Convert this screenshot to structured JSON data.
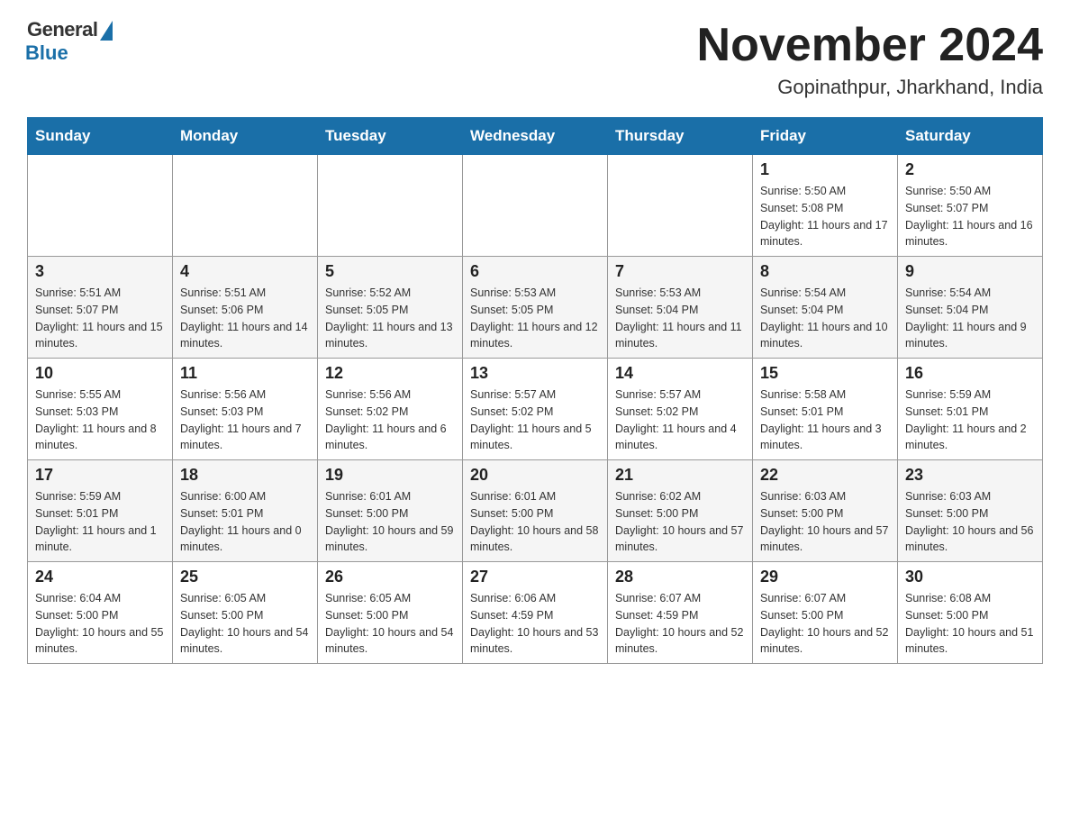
{
  "logo": {
    "general": "General",
    "blue": "Blue"
  },
  "title": "November 2024",
  "location": "Gopinathpur, Jharkhand, India",
  "weekdays": [
    "Sunday",
    "Monday",
    "Tuesday",
    "Wednesday",
    "Thursday",
    "Friday",
    "Saturday"
  ],
  "weeks": [
    [
      {
        "day": "",
        "info": ""
      },
      {
        "day": "",
        "info": ""
      },
      {
        "day": "",
        "info": ""
      },
      {
        "day": "",
        "info": ""
      },
      {
        "day": "",
        "info": ""
      },
      {
        "day": "1",
        "info": "Sunrise: 5:50 AM\nSunset: 5:08 PM\nDaylight: 11 hours and 17 minutes."
      },
      {
        "day": "2",
        "info": "Sunrise: 5:50 AM\nSunset: 5:07 PM\nDaylight: 11 hours and 16 minutes."
      }
    ],
    [
      {
        "day": "3",
        "info": "Sunrise: 5:51 AM\nSunset: 5:07 PM\nDaylight: 11 hours and 15 minutes."
      },
      {
        "day": "4",
        "info": "Sunrise: 5:51 AM\nSunset: 5:06 PM\nDaylight: 11 hours and 14 minutes."
      },
      {
        "day": "5",
        "info": "Sunrise: 5:52 AM\nSunset: 5:05 PM\nDaylight: 11 hours and 13 minutes."
      },
      {
        "day": "6",
        "info": "Sunrise: 5:53 AM\nSunset: 5:05 PM\nDaylight: 11 hours and 12 minutes."
      },
      {
        "day": "7",
        "info": "Sunrise: 5:53 AM\nSunset: 5:04 PM\nDaylight: 11 hours and 11 minutes."
      },
      {
        "day": "8",
        "info": "Sunrise: 5:54 AM\nSunset: 5:04 PM\nDaylight: 11 hours and 10 minutes."
      },
      {
        "day": "9",
        "info": "Sunrise: 5:54 AM\nSunset: 5:04 PM\nDaylight: 11 hours and 9 minutes."
      }
    ],
    [
      {
        "day": "10",
        "info": "Sunrise: 5:55 AM\nSunset: 5:03 PM\nDaylight: 11 hours and 8 minutes."
      },
      {
        "day": "11",
        "info": "Sunrise: 5:56 AM\nSunset: 5:03 PM\nDaylight: 11 hours and 7 minutes."
      },
      {
        "day": "12",
        "info": "Sunrise: 5:56 AM\nSunset: 5:02 PM\nDaylight: 11 hours and 6 minutes."
      },
      {
        "day": "13",
        "info": "Sunrise: 5:57 AM\nSunset: 5:02 PM\nDaylight: 11 hours and 5 minutes."
      },
      {
        "day": "14",
        "info": "Sunrise: 5:57 AM\nSunset: 5:02 PM\nDaylight: 11 hours and 4 minutes."
      },
      {
        "day": "15",
        "info": "Sunrise: 5:58 AM\nSunset: 5:01 PM\nDaylight: 11 hours and 3 minutes."
      },
      {
        "day": "16",
        "info": "Sunrise: 5:59 AM\nSunset: 5:01 PM\nDaylight: 11 hours and 2 minutes."
      }
    ],
    [
      {
        "day": "17",
        "info": "Sunrise: 5:59 AM\nSunset: 5:01 PM\nDaylight: 11 hours and 1 minute."
      },
      {
        "day": "18",
        "info": "Sunrise: 6:00 AM\nSunset: 5:01 PM\nDaylight: 11 hours and 0 minutes."
      },
      {
        "day": "19",
        "info": "Sunrise: 6:01 AM\nSunset: 5:00 PM\nDaylight: 10 hours and 59 minutes."
      },
      {
        "day": "20",
        "info": "Sunrise: 6:01 AM\nSunset: 5:00 PM\nDaylight: 10 hours and 58 minutes."
      },
      {
        "day": "21",
        "info": "Sunrise: 6:02 AM\nSunset: 5:00 PM\nDaylight: 10 hours and 57 minutes."
      },
      {
        "day": "22",
        "info": "Sunrise: 6:03 AM\nSunset: 5:00 PM\nDaylight: 10 hours and 57 minutes."
      },
      {
        "day": "23",
        "info": "Sunrise: 6:03 AM\nSunset: 5:00 PM\nDaylight: 10 hours and 56 minutes."
      }
    ],
    [
      {
        "day": "24",
        "info": "Sunrise: 6:04 AM\nSunset: 5:00 PM\nDaylight: 10 hours and 55 minutes."
      },
      {
        "day": "25",
        "info": "Sunrise: 6:05 AM\nSunset: 5:00 PM\nDaylight: 10 hours and 54 minutes."
      },
      {
        "day": "26",
        "info": "Sunrise: 6:05 AM\nSunset: 5:00 PM\nDaylight: 10 hours and 54 minutes."
      },
      {
        "day": "27",
        "info": "Sunrise: 6:06 AM\nSunset: 4:59 PM\nDaylight: 10 hours and 53 minutes."
      },
      {
        "day": "28",
        "info": "Sunrise: 6:07 AM\nSunset: 4:59 PM\nDaylight: 10 hours and 52 minutes."
      },
      {
        "day": "29",
        "info": "Sunrise: 6:07 AM\nSunset: 5:00 PM\nDaylight: 10 hours and 52 minutes."
      },
      {
        "day": "30",
        "info": "Sunrise: 6:08 AM\nSunset: 5:00 PM\nDaylight: 10 hours and 51 minutes."
      }
    ]
  ]
}
